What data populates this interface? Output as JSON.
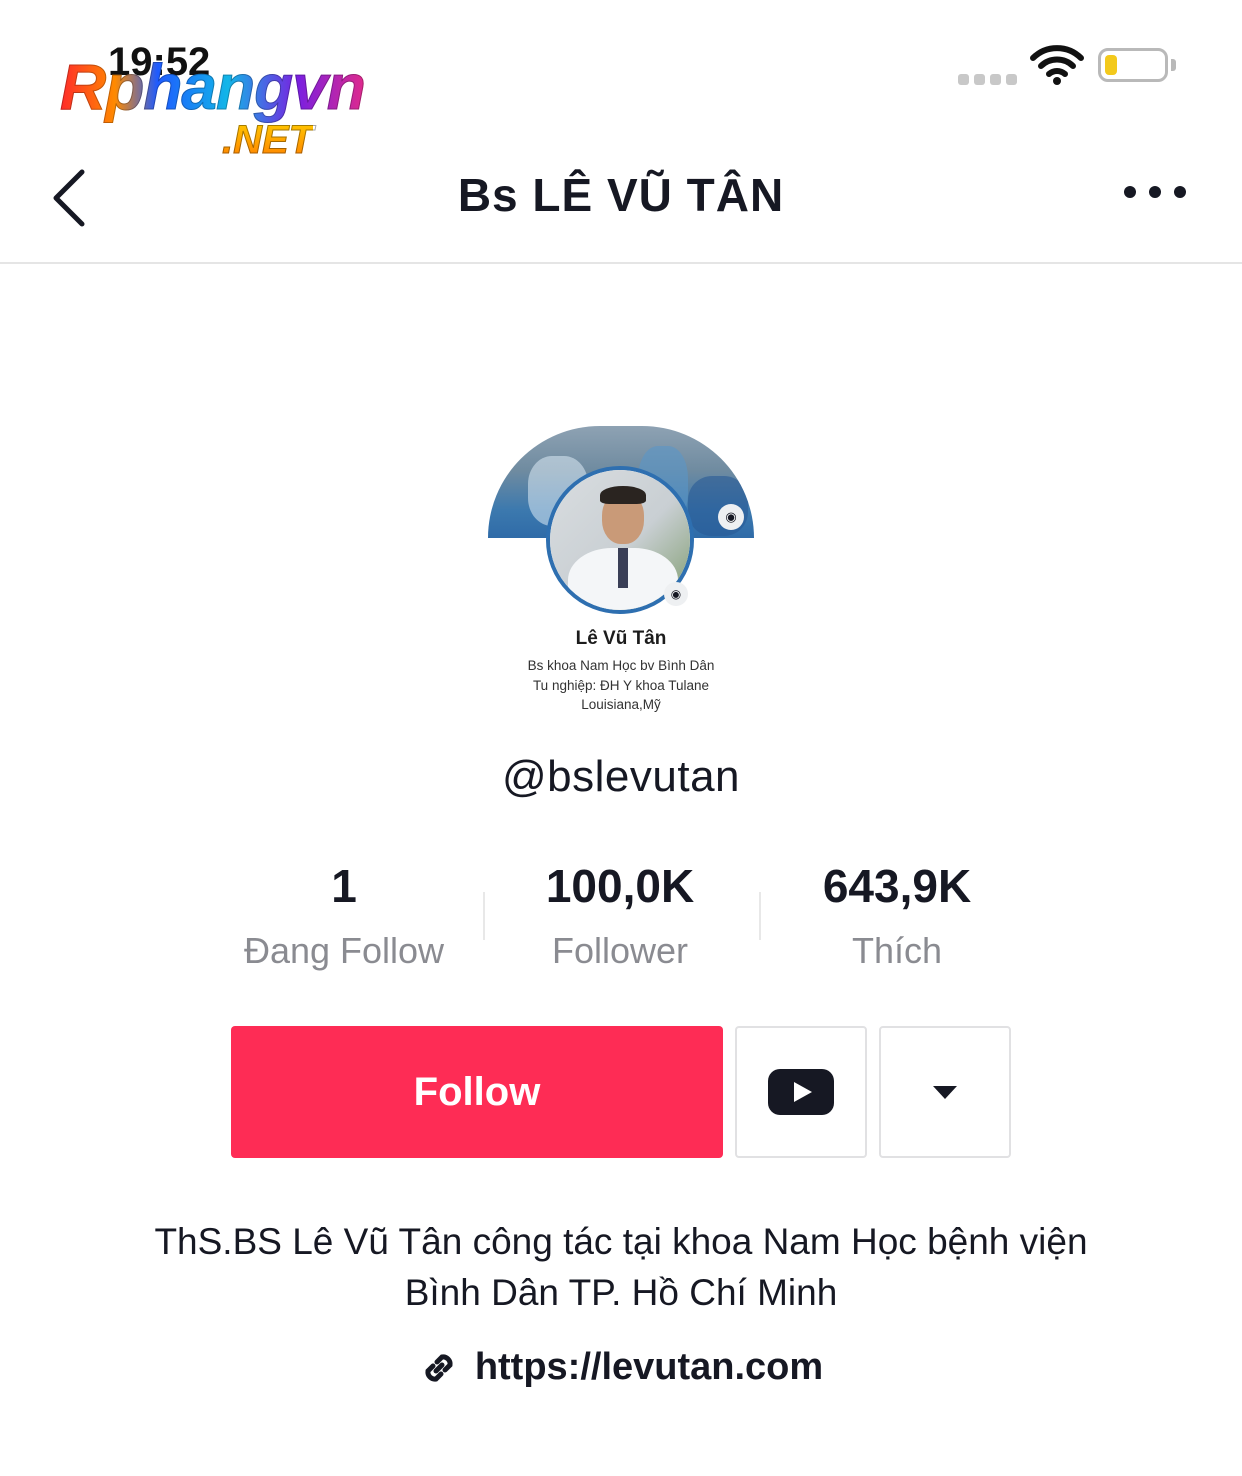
{
  "status_bar": {
    "time": "19:52"
  },
  "watermark": {
    "main": "Rphangvn",
    "suffix": ".NET"
  },
  "nav": {
    "title": "Bs LÊ VŨ TÂN",
    "back_icon": "chevron-left-icon",
    "more_icon": "more-horizontal-icon"
  },
  "profile_card": {
    "name": "Lê Vũ Tân",
    "bio_line_1": "Bs khoa Nam Học bv Bình Dân",
    "bio_line_2": "Tu nghiệp: ĐH Y khoa Tulane",
    "bio_line_3": "Louisiana,Mỹ"
  },
  "username": "@bslevutan",
  "stats": [
    {
      "value": "1",
      "label": "Đang Follow"
    },
    {
      "value": "100,0K",
      "label": "Follower"
    },
    {
      "value": "643,9K",
      "label": "Thích"
    }
  ],
  "actions": {
    "follow_label": "Follow",
    "youtube_icon": "youtube-icon",
    "dropdown_icon": "caret-down-icon"
  },
  "bio": "ThS.BS Lê Vũ Tân công tác tại khoa Nam Học bệnh viện Bình Dân TP. Hồ Chí Minh",
  "link": {
    "icon": "link-icon",
    "text": "https://levutan.com"
  },
  "colors": {
    "follow_button": "#fe2c55",
    "text_primary": "#161823",
    "text_secondary": "#8a8b91"
  }
}
